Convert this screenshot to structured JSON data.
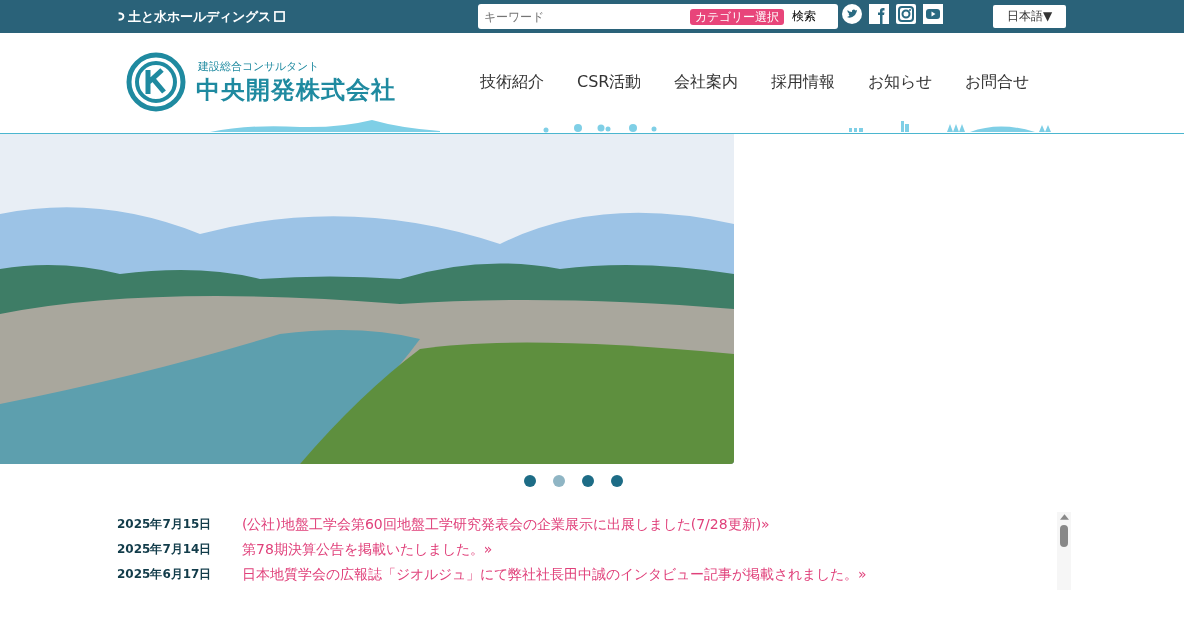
{
  "topbar": {
    "holding_link": "土と水ホールディングス",
    "search": {
      "placeholder": "キーワード",
      "category_button": "カテゴリー選択",
      "submit_button": "検索"
    },
    "language": "日本語▼"
  },
  "header": {
    "logo": {
      "tagline": "建設総合コンサルタント",
      "name": "中央開発株式会社"
    },
    "nav": [
      "技術紹介",
      "CSR活動",
      "会社案内",
      "採用情報",
      "お知らせ",
      "お問合せ"
    ]
  },
  "carousel": {
    "dots": [
      {
        "selected": false
      },
      {
        "selected": true
      },
      {
        "selected": false
      },
      {
        "selected": false
      }
    ]
  },
  "news": [
    {
      "date": "2025年7月15日",
      "title": "(公社)地盤工学会第60回地盤工学研究発表会の企業展示に出展しました(7/28更新)»"
    },
    {
      "date": "2025年7月14日",
      "title": "第78期決算公告を掲載いたしました。»"
    },
    {
      "date": "2025年6月17日",
      "title": "日本地質学会の広報誌「ジオルジュ」にて弊社社長田中誠のインタビュー記事が掲載されました。»"
    }
  ]
}
